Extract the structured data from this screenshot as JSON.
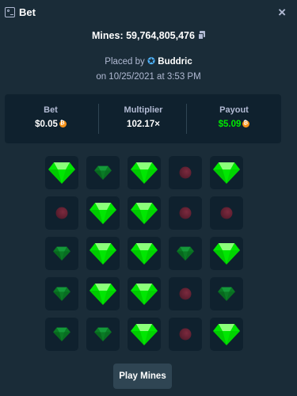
{
  "header": {
    "title": "Bet",
    "close_label": "×"
  },
  "game": {
    "id_text": "Mines: 59,764,805,476",
    "placed_by_prefix": "Placed by",
    "user": "Buddric",
    "date_text": "on 10/25/2021 at 3:53 PM"
  },
  "stats": {
    "bet_label": "Bet",
    "bet_value": "$0.05",
    "multiplier_label": "Multiplier",
    "multiplier_value": "102.17×",
    "payout_label": "Payout",
    "payout_value": "$5.09"
  },
  "grid": [
    [
      "gem-revealed",
      "gem",
      "gem-revealed",
      "mine",
      "gem-revealed"
    ],
    [
      "mine",
      "gem-revealed",
      "gem-revealed",
      "mine",
      "mine"
    ],
    [
      "gem",
      "gem-revealed",
      "gem-revealed",
      "gem",
      "gem-revealed"
    ],
    [
      "gem",
      "gem-revealed",
      "gem-revealed",
      "mine",
      "gem"
    ],
    [
      "gem",
      "gem",
      "gem-revealed",
      "mine",
      "gem-revealed"
    ]
  ],
  "colors": {
    "gem_bright": "#00e701",
    "gem_dim": "#0a7a25",
    "mine": "#6b2235",
    "payout": "#00e701"
  },
  "actions": {
    "play_label": "Play Mines"
  }
}
